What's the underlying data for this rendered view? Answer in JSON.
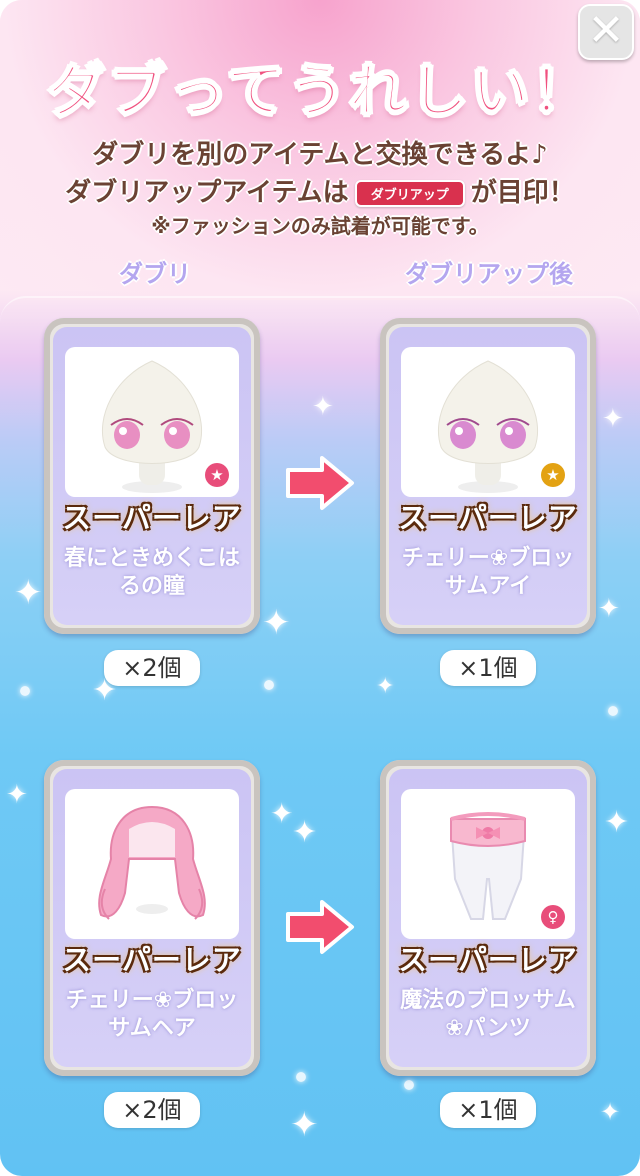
{
  "header": {
    "title": "ダブってうれしい！",
    "line1": "ダブリを別のアイテムと交換できるよ♪",
    "line2_before": "ダブリアップアイテムは",
    "line2_badge": "ダブリアップ",
    "line2_after": "が目印！",
    "note": "※ファッションのみ試着が可能です。",
    "close_glyph": "✕"
  },
  "columns": {
    "left": "ダブリ",
    "right": "ダブリアップ後"
  },
  "pairs": [
    {
      "before": {
        "rarity": "スーパーレア",
        "name": "春にときめくこはるの瞳",
        "count": "×2個",
        "icon": "eye-icon"
      },
      "after": {
        "rarity": "スーパーレア",
        "name": "チェリー❀ブロッサムアイ",
        "count": "×1個",
        "icon": "eye-icon"
      }
    },
    {
      "before": {
        "rarity": "スーパーレア",
        "name": "チェリー❀ブロッサムヘア",
        "count": "×2個",
        "icon": "hair-icon"
      },
      "after": {
        "rarity": "スーパーレア",
        "name": "魔法のブロッサム❀パンツ",
        "count": "×1個",
        "icon": "pants-icon"
      }
    }
  ],
  "colors": {
    "title": "#f0517f",
    "text": "#6a4233",
    "arrow": "#f24d6e",
    "badge": "#d9314e"
  }
}
